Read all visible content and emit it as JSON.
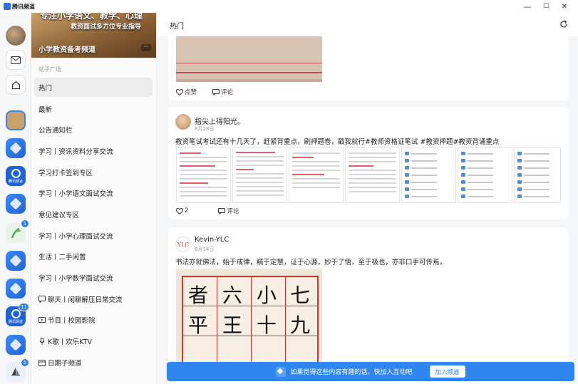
{
  "app": {
    "title": "腾讯频道"
  },
  "window": {
    "minimize": "—",
    "maximize": "☐",
    "close": "✕"
  },
  "rail": {
    "badges": {
      "green_channel": "1",
      "tx_channel": "11",
      "sail_channel": "5"
    },
    "tx_label": "腾讯频道"
  },
  "channel": {
    "banner_line1": "专注小学语文、教学、心理",
    "banner_line2": "教资面试多方位专业指导",
    "name": "小学教资备考频道",
    "more": "···",
    "section_title": "帖子广场",
    "nav": [
      {
        "label": "热门",
        "icon": ""
      },
      {
        "label": "最新",
        "icon": ""
      },
      {
        "label": "公告通知栏",
        "icon": ""
      },
      {
        "label": "学习丨资讯资料分享交流",
        "icon": ""
      },
      {
        "label": "学习打卡签到专区",
        "icon": ""
      },
      {
        "label": "学习丨小学语文面试交流",
        "icon": ""
      },
      {
        "label": "意见建议专区",
        "icon": ""
      },
      {
        "label": "学习丨小学心理面试交流",
        "icon": ""
      },
      {
        "label": "生活丨二手闲置",
        "icon": ""
      },
      {
        "label": "学习丨小学数学面试交流",
        "icon": ""
      },
      {
        "label": "聊天丨闲聊解压日常交流",
        "icon": "chat-icon"
      },
      {
        "label": "节目丨校园影院",
        "icon": "video-icon"
      },
      {
        "label": "K歌丨欢乐KTV",
        "icon": "mic-icon"
      },
      {
        "label": "日期子频道",
        "icon": "calendar-icon"
      }
    ]
  },
  "main": {
    "title": "热门",
    "post0": {
      "like": "点赞",
      "comment": "评论"
    },
    "post1": {
      "author": "指尖上得阳光。",
      "date": "8月28日",
      "text": "教资笔试考试还有十几天了，赶紧背重点，刷押题卷，戳我就行#教师资格证笔试 #教资押题#教资背诵重点",
      "likes": "2",
      "comment": "评论"
    },
    "post2": {
      "author": "Kevin-YLC",
      "avatar_text": "YLC",
      "date": "8月14日",
      "text": "书法亦就佛法，始于戒律，精于定慧，证于心源，妙于了悟，至于极也，亦非口手可传焉。",
      "calligraphy": [
        "七",
        "小",
        "六",
        "者",
        "九",
        "十",
        "王",
        "平"
      ]
    }
  },
  "joinbar": {
    "text": "如果觉得这些内容有趣的话，快加入互动吧",
    "button": "加入频道"
  },
  "colors": {
    "accent": "#2f86f0",
    "rail_bg": "#f6f7f9",
    "feed_bg": "#f5f6f8"
  }
}
